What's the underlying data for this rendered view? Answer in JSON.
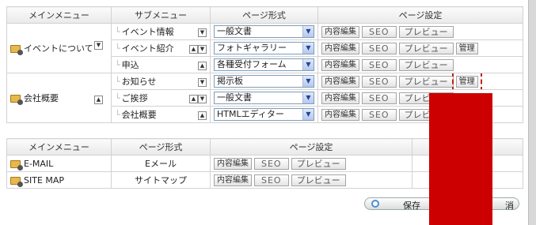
{
  "upper_table": {
    "headers": [
      "メインメニュー",
      "サブメニュー",
      "ページ形式",
      "ページ設定"
    ],
    "groups": [
      {
        "menu": "イベントについて",
        "rows": [
          {
            "sub": "イベント情報",
            "format": "一般文書"
          },
          {
            "sub": "イベント紹介",
            "format": "フォトギャラリー"
          },
          {
            "sub": "申込",
            "format": "各種受付フォーム"
          }
        ]
      },
      {
        "menu": "会社概要",
        "rows": [
          {
            "sub": "お知らせ",
            "format": "掲示板"
          },
          {
            "sub": "ご挨拶",
            "format": "一般文書"
          },
          {
            "sub": "会社概要",
            "format": "HTMLエディター"
          }
        ]
      }
    ]
  },
  "buttons": {
    "edit": "内容編集",
    "seo": "SEO",
    "preview": "プレビュー",
    "manage": "管理"
  },
  "lower_table": {
    "headers": [
      "メインメニュー",
      "ページ形式",
      "ページ設定"
    ],
    "rows": [
      {
        "menu": "E-MAIL",
        "format": "Eメール"
      },
      {
        "menu": "SITE MAP",
        "format": "サイトマップ"
      }
    ]
  },
  "footer": {
    "save": "保存",
    "other": "消"
  },
  "colors": {
    "highlight": "#cc0000",
    "folder": "#e7b84b"
  }
}
